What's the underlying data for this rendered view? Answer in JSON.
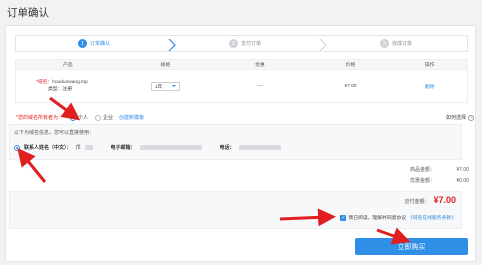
{
  "page": {
    "title": "订单确认"
  },
  "steps": [
    {
      "num": "1",
      "label": "订单确认"
    },
    {
      "num": "2",
      "label": "支付订单"
    },
    {
      "num": "3",
      "label": "完成订单"
    }
  ],
  "table": {
    "headers": [
      "产品",
      "规格",
      "优惠",
      "价格",
      "操作"
    ],
    "row": {
      "domain_label": "*域名：",
      "domain": "houdunwang.top",
      "type_label": "类型：",
      "type": "注册",
      "spec": "1年",
      "discount": "----",
      "price": "¥7.00",
      "action": "删除"
    }
  },
  "owner": {
    "label": "*您的域名所有者为：",
    "options": [
      "个人",
      "企业"
    ],
    "selected": "个人",
    "template_link": "创建新模板",
    "how_to": "如何选择"
  },
  "info": {
    "hint": "以下为域名信息，您可以直接使用：",
    "name_label": "联系人姓名（中文）：",
    "name_value": "邝",
    "email_label": "电子邮箱：",
    "phone_label": "电话："
  },
  "sums": {
    "goods_label": "商品金额：",
    "goods_value": "¥7.00",
    "discount_label": "优惠金额：",
    "discount_value": "¥0.00"
  },
  "payment": {
    "label": "应付金额：",
    "amount": "¥7.00",
    "agree_text": "我已阅读，理解并同意协议",
    "agreement_link": "《域名在线服务条款》",
    "buy_button": "立即购买"
  },
  "colors": {
    "accent": "#2f8ee6",
    "price": "#e02020",
    "arrow": "#e02020"
  }
}
